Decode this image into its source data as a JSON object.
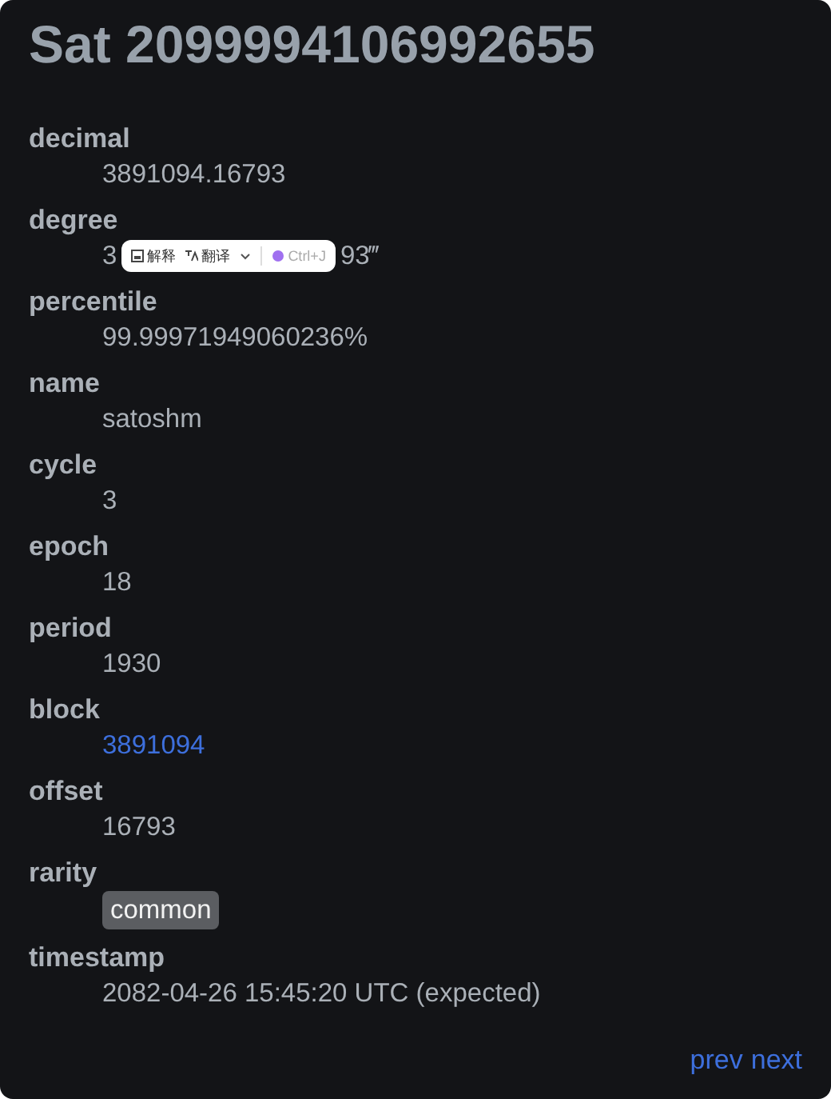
{
  "title": "Sat 2099994106992655",
  "fields": [
    {
      "kind": "text",
      "label": "decimal",
      "value": "3891094.16793"
    },
    {
      "kind": "covered",
      "label": "degree",
      "value_start": "3",
      "value_end": "93‴",
      "popup": {
        "explain": "解释",
        "translate": "翻译",
        "shortcut": "Ctrl+J"
      }
    },
    {
      "kind": "text",
      "label": "percentile",
      "value": "99.99971949060236%"
    },
    {
      "kind": "text",
      "label": "name",
      "value": "satoshm"
    },
    {
      "kind": "text",
      "label": "cycle",
      "value": "3"
    },
    {
      "kind": "text",
      "label": "epoch",
      "value": "18"
    },
    {
      "kind": "text",
      "label": "period",
      "value": "1930"
    },
    {
      "kind": "link",
      "label": "block",
      "value": "3891094"
    },
    {
      "kind": "text",
      "label": "offset",
      "value": "16793"
    },
    {
      "kind": "badge",
      "label": "rarity",
      "value": "common"
    },
    {
      "kind": "text",
      "label": "timestamp",
      "value": "2082-04-26 15:45:20 UTC (expected)"
    }
  ],
  "nav": [
    "prev",
    "next"
  ]
}
